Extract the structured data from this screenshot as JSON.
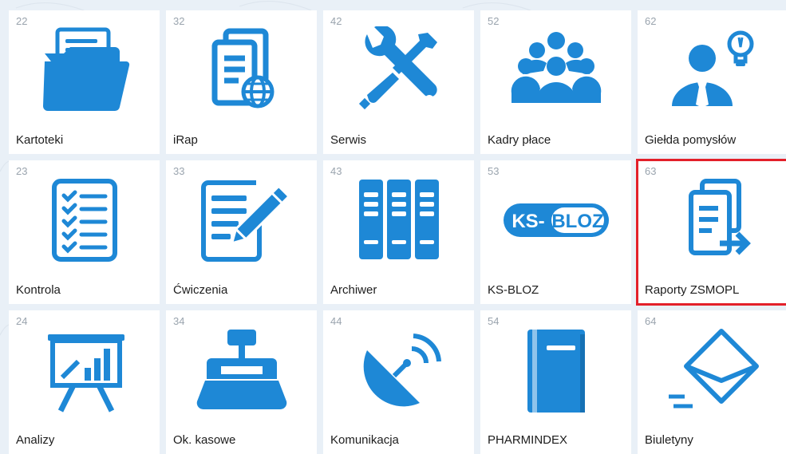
{
  "accent": "#1e88d6",
  "selection_color": "#e3202a",
  "tiles": [
    {
      "num": "22",
      "label": "Kartoteki",
      "icon": "folder-documents-icon"
    },
    {
      "num": "32",
      "label": "iRap",
      "icon": "document-globe-icon"
    },
    {
      "num": "42",
      "label": "Serwis",
      "icon": "wrench-screwdriver-icon"
    },
    {
      "num": "52",
      "label": "Kadry płace",
      "icon": "people-group-icon"
    },
    {
      "num": "62",
      "label": "Giełda pomysłów",
      "icon": "person-lightbulb-icon"
    },
    {
      "num": "23",
      "label": "Kontrola",
      "icon": "checklist-icon"
    },
    {
      "num": "33",
      "label": "Ćwiczenia",
      "icon": "document-pencil-icon"
    },
    {
      "num": "43",
      "label": "Archiwer",
      "icon": "binders-icon"
    },
    {
      "num": "53",
      "label": "KS-BLOZ",
      "icon": "ks-bloz-logo-icon",
      "logo_text_left": "KS-",
      "logo_text_right": "BLOZ"
    },
    {
      "num": "63",
      "label": "Raporty ZSMOPL",
      "icon": "documents-export-icon",
      "selected": true
    },
    {
      "num": "24",
      "label": "Analizy",
      "icon": "presentation-chart-icon"
    },
    {
      "num": "34",
      "label": "Ok. kasowe",
      "icon": "cash-register-icon"
    },
    {
      "num": "44",
      "label": "Komunikacja",
      "icon": "satellite-dish-icon"
    },
    {
      "num": "54",
      "label": "PHARMINDEX",
      "icon": "book-icon"
    },
    {
      "num": "64",
      "label": "Biuletyny",
      "icon": "envelope-icon"
    }
  ]
}
